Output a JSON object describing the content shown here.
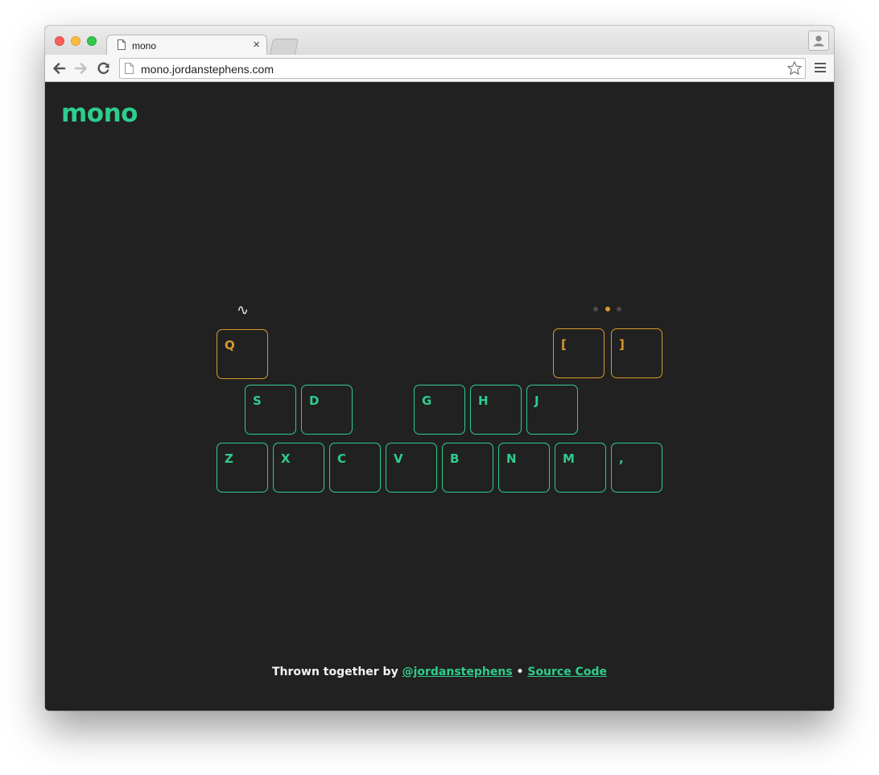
{
  "browser": {
    "tab_title": "mono",
    "tab_close": "×",
    "url": "mono.jordanstephens.com"
  },
  "app": {
    "logo": "mono",
    "waveform_symbol": "∿",
    "octave_indicator": {
      "count": 3,
      "active_index": 1,
      "active_color": "#d99a2b",
      "inactive_color": "#4a4a4a"
    }
  },
  "keyboard": {
    "accent_color": "#2ecc8d",
    "control_color": "#d99a2b",
    "control_keys": [
      "Q",
      "[",
      "]"
    ],
    "upper_row": [
      "S",
      "D",
      "G",
      "H",
      "J"
    ],
    "lower_row": [
      "Z",
      "X",
      "C",
      "V",
      "B",
      "N",
      "M",
      ","
    ]
  },
  "footer": {
    "prefix": "Thrown together by",
    "author_link": "@jordanstephens",
    "separator": "•",
    "source_link": "Source Code"
  }
}
